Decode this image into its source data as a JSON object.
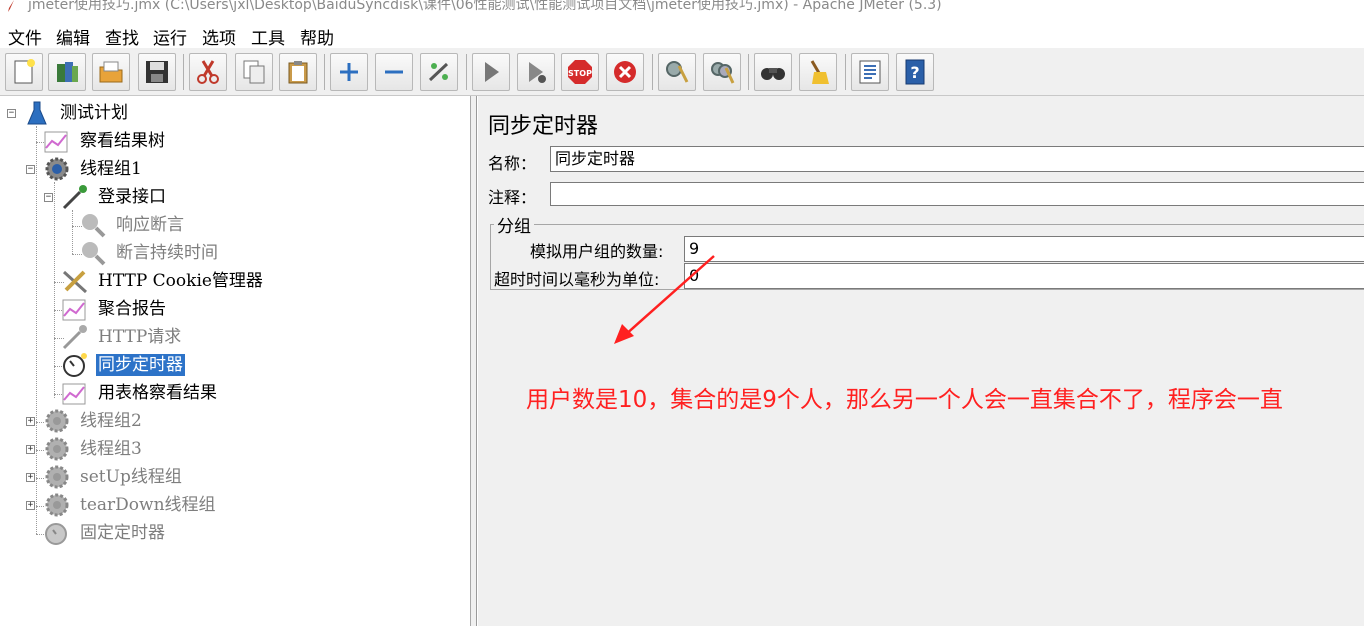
{
  "window": {
    "title": "jmeter使用技巧.jmx (C:\\Users\\jxl\\Desktop\\BaiduSyncdisk\\课件\\06性能测试\\性能测试项目文档\\jmeter使用技巧.jmx) - Apache JMeter (5.3)"
  },
  "menu": [
    "文件",
    "编辑",
    "查找",
    "运行",
    "选项",
    "工具",
    "帮助"
  ],
  "toolbar": {
    "buttons": [
      "new-icon",
      "templates-icon",
      "open-icon",
      "save-icon",
      "cut-icon",
      "copy-icon",
      "paste-icon",
      "expand-icon",
      "collapse-icon",
      "toggle-icon",
      "start-icon",
      "start-no-pause-icon",
      "stop-icon",
      "shutdown-icon",
      "clear-icon",
      "clear-all-icon",
      "search-icon",
      "reset-search-icon",
      "function-helper-icon",
      "help-icon"
    ]
  },
  "tree": {
    "nodes": [
      {
        "label": "测试计划",
        "icon": "test-plan-icon",
        "disabled": false
      },
      {
        "label": "察看结果树",
        "icon": "listener-icon",
        "disabled": false
      },
      {
        "label": "线程组1",
        "icon": "thread-group-icon",
        "disabled": false
      },
      {
        "label": "登录接口",
        "icon": "sampler-icon",
        "disabled": false
      },
      {
        "label": "响应断言",
        "icon": "assertion-icon",
        "disabled": true
      },
      {
        "label": "断言持续时间",
        "icon": "assertion-icon",
        "disabled": true
      },
      {
        "label": "HTTP Cookie管理器",
        "icon": "config-icon",
        "disabled": false
      },
      {
        "label": "聚合报告",
        "icon": "listener-icon",
        "disabled": false
      },
      {
        "label": "HTTP请求",
        "icon": "sampler-icon",
        "disabled": true
      },
      {
        "label": "同步定时器",
        "icon": "timer-icon",
        "disabled": false,
        "selected": true
      },
      {
        "label": "用表格察看结果",
        "icon": "listener-icon",
        "disabled": false
      },
      {
        "label": "线程组2",
        "icon": "thread-group-icon",
        "disabled": true
      },
      {
        "label": "线程组3",
        "icon": "thread-group-icon",
        "disabled": true
      },
      {
        "label": "setUp线程组",
        "icon": "thread-group-icon",
        "disabled": true
      },
      {
        "label": "tearDown线程组",
        "icon": "thread-group-icon",
        "disabled": true
      },
      {
        "label": "固定定时器",
        "icon": "timer-icon",
        "disabled": true
      }
    ]
  },
  "panel": {
    "title": "同步定时器",
    "name_label": "名称：",
    "name_value": "同步定时器",
    "comment_label": "注释：",
    "comment_value": "",
    "group_title": "分组",
    "users_label": "模拟用户组的数量:",
    "users_value": "9",
    "timeout_label": "超时时间以毫秒为单位:",
    "timeout_value": "0"
  },
  "annotation": {
    "text": "用户数是10，集合的是9个人，那么另一个人会一直集合不了，程序会一直",
    "color": "#ff2020"
  }
}
